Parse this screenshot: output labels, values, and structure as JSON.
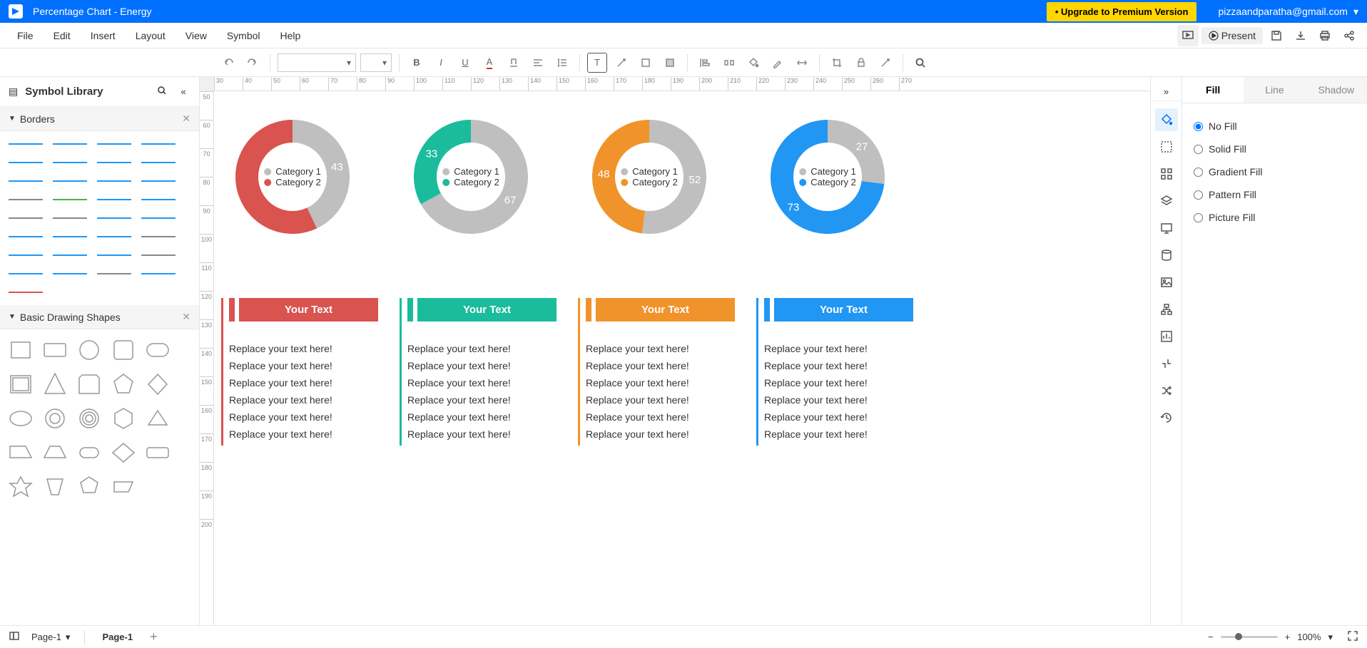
{
  "titlebar": {
    "title": "Percentage Chart - Energy",
    "upgrade": "• Upgrade to Premium Version",
    "account": "pizzaandparatha@gmail.com"
  },
  "menu": {
    "file": "File",
    "edit": "Edit",
    "insert": "Insert",
    "layout": "Layout",
    "view": "View",
    "symbol": "Symbol",
    "help": "Help",
    "present": "Present"
  },
  "library": {
    "title": "Symbol Library",
    "borders": "Borders",
    "shapes": "Basic Drawing Shapes"
  },
  "rightTabs": {
    "fill": "Fill",
    "line": "Line",
    "shadow": "Shadow"
  },
  "fillOpts": {
    "none": "No Fill",
    "solid": "Solid Fill",
    "grad": "Gradient Fill",
    "pat": "Pattern Fill",
    "pic": "Picture Fill"
  },
  "status": {
    "pageSelect": "Page-1",
    "pageTab": "Page-1",
    "zoom": "100%"
  },
  "chart_data": [
    {
      "type": "donut",
      "title": "",
      "series": [
        {
          "name": "Category 1",
          "value": 43,
          "color": "#bfbfbf"
        },
        {
          "name": "Category 2",
          "value": 57,
          "color": "#d9534f"
        }
      ],
      "labels": [
        "43"
      ]
    },
    {
      "type": "donut",
      "title": "",
      "series": [
        {
          "name": "Category 1",
          "value": 67,
          "color": "#bfbfbf"
        },
        {
          "name": "Category 2",
          "value": 33,
          "color": "#1abc9c"
        }
      ],
      "labels": [
        "67",
        "33"
      ]
    },
    {
      "type": "donut",
      "title": "",
      "series": [
        {
          "name": "Category 1",
          "value": 52,
          "color": "#bfbfbf"
        },
        {
          "name": "Category 2",
          "value": 48,
          "color": "#f0932b"
        }
      ],
      "labels": [
        "52",
        "48"
      ]
    },
    {
      "type": "donut",
      "title": "",
      "series": [
        {
          "name": "Category 1",
          "value": 27,
          "color": "#bfbfbf"
        },
        {
          "name": "Category 2",
          "value": 73,
          "color": "#2196f3"
        }
      ],
      "labels": [
        "27",
        "73"
      ]
    }
  ],
  "columns": [
    {
      "color": "#d9534f",
      "title": "Your Text",
      "lines": [
        "Replace your text here!",
        "Replace your text here!",
        "Replace your text here!",
        "Replace your text here!",
        "Replace your text here!",
        "Replace your text here!"
      ]
    },
    {
      "color": "#1abc9c",
      "title": "Your Text",
      "lines": [
        "Replace your text here!",
        "Replace your text here!",
        "Replace your text here!",
        "Replace your text here!",
        "Replace your text here!",
        "Replace your text here!"
      ]
    },
    {
      "color": "#f0932b",
      "title": "Your Text",
      "lines": [
        "Replace your text here!",
        "Replace your text here!",
        "Replace your text here!",
        "Replace your text here!",
        "Replace your text here!",
        "Replace your text here!"
      ]
    },
    {
      "color": "#2196f3",
      "title": "Your Text",
      "lines": [
        "Replace your text here!",
        "Replace your text here!",
        "Replace your text here!",
        "Replace your text here!",
        "Replace your text here!",
        "Replace your text here!"
      ]
    }
  ],
  "ruler_h": [
    "30",
    "40",
    "50",
    "60",
    "70",
    "80",
    "90",
    "100",
    "110",
    "120",
    "130",
    "140",
    "150",
    "160",
    "170",
    "180",
    "190",
    "200",
    "210",
    "220",
    "230",
    "240",
    "250",
    "260",
    "270"
  ],
  "ruler_v": [
    "50",
    "60",
    "70",
    "80",
    "90",
    "100",
    "110",
    "120",
    "130",
    "140",
    "150",
    "160",
    "170",
    "180",
    "190",
    "200"
  ]
}
